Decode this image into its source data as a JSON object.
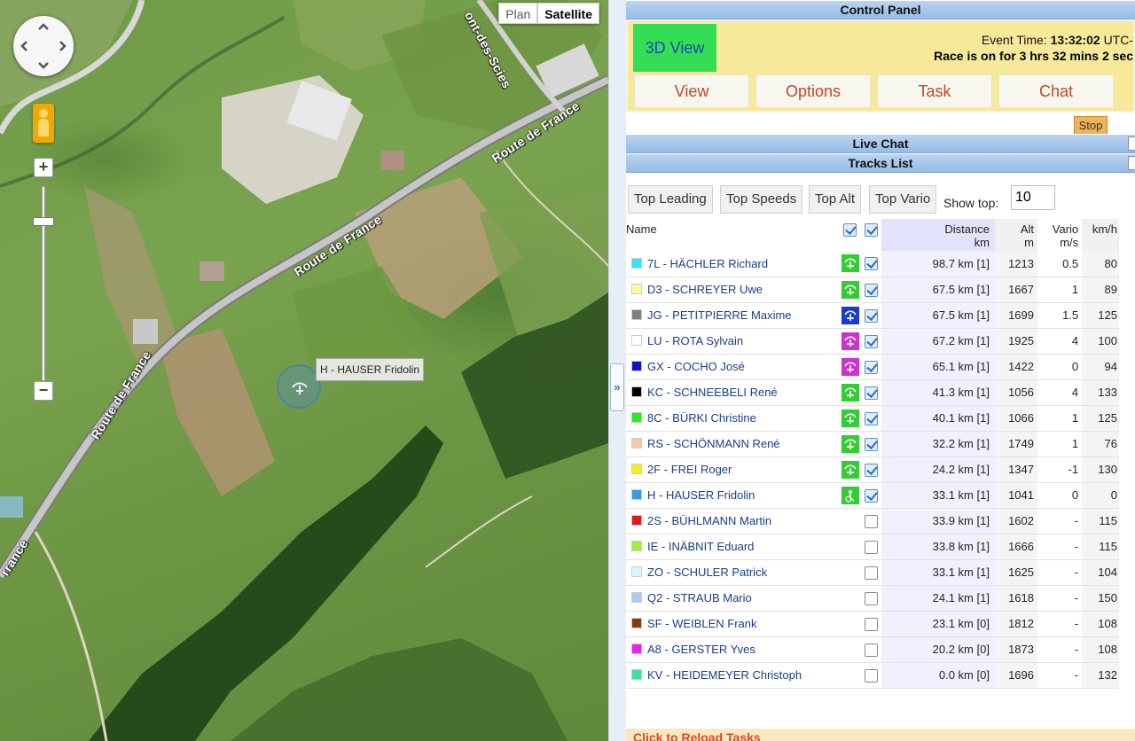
{
  "map": {
    "map_type_buttons": [
      "Plan",
      "Satellite"
    ],
    "active_map_type": "Satellite",
    "zoom_in": "+",
    "zoom_out": "−",
    "marker_label": "H - HAUSER Fridolin",
    "road_labels": [
      "Route de France",
      "Route de France",
      "Route de France",
      "Route de France",
      "ont-des-Scies",
      "rrance"
    ]
  },
  "splitter": {
    "handle_label": "»"
  },
  "control_panel": {
    "title": "Control Panel",
    "view_3d": "3D View",
    "event_time_label": "Event Time:",
    "event_time_value": "13:32:02",
    "event_time_tz": "UTC-",
    "race_status": "Race is on for 3 hrs 32 mins 2 sec",
    "tabs": [
      "View",
      "Options",
      "Task",
      "Chat"
    ],
    "stop": "Stop"
  },
  "live_chat": {
    "title": "Live Chat"
  },
  "tracks_list": {
    "title": "Tracks List",
    "filters": [
      "Top Leading",
      "Top Speeds",
      "Top Alt",
      "Top Vario"
    ],
    "show_top_label": "Show top:",
    "show_top_value": "10",
    "columns": {
      "name": "Name",
      "distance": "Distance",
      "distance_unit": "km",
      "alt": "Alt",
      "alt_unit": "m",
      "vario": "Vario",
      "vario_unit": "m/s",
      "kmh": "km/h"
    },
    "rows": [
      {
        "name": "7L - HÄCHLER Richard",
        "color": "#33e5f0",
        "icon_color": "#33cc33",
        "icon": "glider",
        "checked": true,
        "distance": "98.7 km [1]",
        "alt": "1213",
        "vario": "0.5",
        "kmh": "80"
      },
      {
        "name": "D3 - SCHREYER Uwe",
        "color": "#fff9a0",
        "icon_color": "#33cc33",
        "icon": "glider",
        "checked": true,
        "distance": "67.5 km [1]",
        "alt": "1667",
        "vario": "1",
        "kmh": "89"
      },
      {
        "name": "JG - PETITPIERRE Maxime",
        "color": "#808080",
        "icon_color": "#1a3cc8",
        "icon": "glider",
        "checked": true,
        "distance": "67.5 km [1]",
        "alt": "1699",
        "vario": "1.5",
        "kmh": "125"
      },
      {
        "name": "LU - ROTA Sylvain",
        "color": "#ffffff",
        "icon_color": "#cc33cc",
        "icon": "glider",
        "checked": true,
        "distance": "67.2 km [1]",
        "alt": "1925",
        "vario": "4",
        "kmh": "100"
      },
      {
        "name": "GX - COCHO José",
        "color": "#1010c8",
        "icon_color": "#cc33cc",
        "icon": "glider",
        "checked": true,
        "distance": "65.1 km [1]",
        "alt": "1422",
        "vario": "0",
        "kmh": "94"
      },
      {
        "name": "KC - SCHNEEBELI René",
        "color": "#000000",
        "icon_color": "#33cc33",
        "icon": "glider",
        "checked": true,
        "distance": "41.3 km [1]",
        "alt": "1056",
        "vario": "4",
        "kmh": "133"
      },
      {
        "name": "8C - BÜRKI Christine",
        "color": "#22ee22",
        "icon_color": "#33cc33",
        "icon": "glider",
        "checked": true,
        "distance": "40.1 km [1]",
        "alt": "1066",
        "vario": "1",
        "kmh": "125"
      },
      {
        "name": "RS - SCHÖNMANN René",
        "color": "#f7c8a8",
        "icon_color": "#33cc33",
        "icon": "glider",
        "checked": true,
        "distance": "32.2 km [1]",
        "alt": "1749",
        "vario": "1",
        "kmh": "76"
      },
      {
        "name": "2F - FREI Roger",
        "color": "#f7f020",
        "icon_color": "#33cc33",
        "icon": "glider",
        "checked": true,
        "distance": "24.2 km [1]",
        "alt": "1347",
        "vario": "-1",
        "kmh": "130"
      },
      {
        "name": "H - HAUSER Fridolin",
        "color": "#3a9ae0",
        "icon_color": "#33cc33",
        "icon": "landed",
        "checked": true,
        "distance": "33.1 km [1]",
        "alt": "1041",
        "vario": "0",
        "kmh": "0"
      },
      {
        "name": "2S - BÜHLMANN Martin",
        "color": "#e01818",
        "icon_color": "",
        "icon": "",
        "checked": false,
        "distance": "33.9 km [1]",
        "alt": "1602",
        "vario": "-",
        "kmh": "115"
      },
      {
        "name": "IE - INÄBNIT Eduard",
        "color": "#a0f040",
        "icon_color": "",
        "icon": "",
        "checked": false,
        "distance": "33.8 km [1]",
        "alt": "1666",
        "vario": "-",
        "kmh": "115"
      },
      {
        "name": "ZO - SCHULER Patrick",
        "color": "#d8f8fb",
        "icon_color": "",
        "icon": "",
        "checked": false,
        "distance": "33.1 km [1]",
        "alt": "1625",
        "vario": "-",
        "kmh": "104"
      },
      {
        "name": "Q2 - STRAUB Mario",
        "color": "#a8cdf0",
        "icon_color": "",
        "icon": "",
        "checked": false,
        "distance": "24.1 km [1]",
        "alt": "1618",
        "vario": "-",
        "kmh": "150"
      },
      {
        "name": "SF - WEIBLEN Frank",
        "color": "#8a3a10",
        "icon_color": "",
        "icon": "",
        "checked": false,
        "distance": "23.1 km [0]",
        "alt": "1812",
        "vario": "-",
        "kmh": "108"
      },
      {
        "name": "A8 - GERSTER Yves",
        "color": "#f020e8",
        "icon_color": "",
        "icon": "",
        "checked": false,
        "distance": "20.2 km [0]",
        "alt": "1873",
        "vario": "-",
        "kmh": "108"
      },
      {
        "name": "KV - HEIDEMEYER Christoph",
        "color": "#3ee0a0",
        "icon_color": "",
        "icon": "",
        "checked": false,
        "distance": "0.0 km [0]",
        "alt": "1696",
        "vario": "-",
        "kmh": "132"
      }
    ]
  },
  "reload_bar": "Click to Reload Tasks"
}
